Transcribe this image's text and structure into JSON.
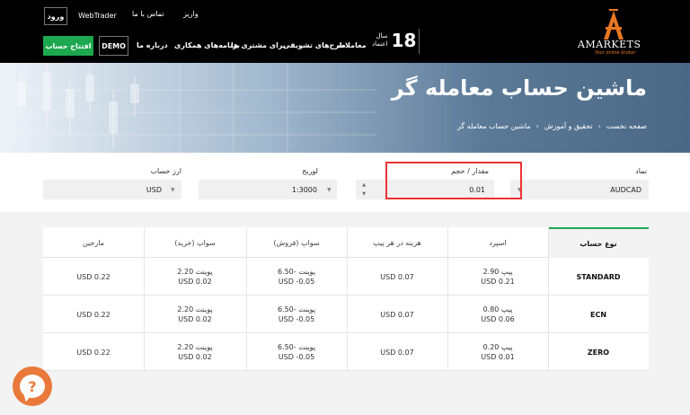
{
  "header": {
    "login_label": "ورود",
    "webtrader_label": "WebTrader",
    "contact_label": "تماس با ما",
    "deposit_label": "واریز",
    "open_account_label": "افتتاح حساب",
    "demo_label": "DEMO",
    "nav": [
      "درباره ما",
      "برنامه‌های همکاری",
      "برای مشتری ها",
      "طرح‌های تشویقی",
      "معاملات"
    ],
    "years_number": "18",
    "years_line1": "سال",
    "years_line2": "اعتماد",
    "logo_word": "AMARKETS",
    "logo_tagline": "Your online broker"
  },
  "banner": {
    "title": "ماشین حساب معامله گر",
    "breadcrumb": [
      "صفحه نخست",
      "تحقیق و آموزش",
      "ماشین حساب معامله گر"
    ]
  },
  "form": {
    "symbol": {
      "label": "نماد",
      "value": "AUDCAD"
    },
    "volume": {
      "label": "مقدار / حجم",
      "value": "0.01"
    },
    "leverage": {
      "label": "لوریج",
      "value": "1:3000"
    },
    "currency": {
      "label": "ارز حساب",
      "value": "USD"
    }
  },
  "table": {
    "headers": [
      "نوع حساب",
      "اسپرد",
      "هزینه در هر پیپ",
      "سواپ (فروش)",
      "سواپ (خرید)",
      "مارجین"
    ],
    "rows": [
      {
        "account": "STANDARD",
        "spread1": "2.90 پیپ",
        "spread2": "USD 0.21",
        "pip_cost": "USD 0.07",
        "swap_sell1": "6.50- پوینت",
        "swap_sell2": "USD -0.05",
        "swap_buy1": "2.20 پوینت",
        "swap_buy2": "USD 0.02",
        "margin": "USD 0.22"
      },
      {
        "account": "ECN",
        "spread1": "0.80 پیپ",
        "spread2": "USD 0.06",
        "pip_cost": "USD 0.07",
        "swap_sell1": "6.50- پوینت",
        "swap_sell2": "USD -0.05",
        "swap_buy1": "2.20 پوینت",
        "swap_buy2": "USD 0.02",
        "margin": "USD 0.22"
      },
      {
        "account": "ZERO",
        "spread1": "0.20 پیپ",
        "spread2": "USD 0.01",
        "pip_cost": "USD 0.07",
        "swap_sell1": "6.50- پوینت",
        "swap_sell2": "USD -0.05",
        "swap_buy1": "2.20 پوینت",
        "swap_buy2": "USD 0.02",
        "margin": "USD 0.22"
      }
    ]
  },
  "help_symbol": "?",
  "colors": {
    "brand_green": "#1da84f",
    "brand_orange": "#e8793a",
    "highlight_red": "#e33333"
  }
}
